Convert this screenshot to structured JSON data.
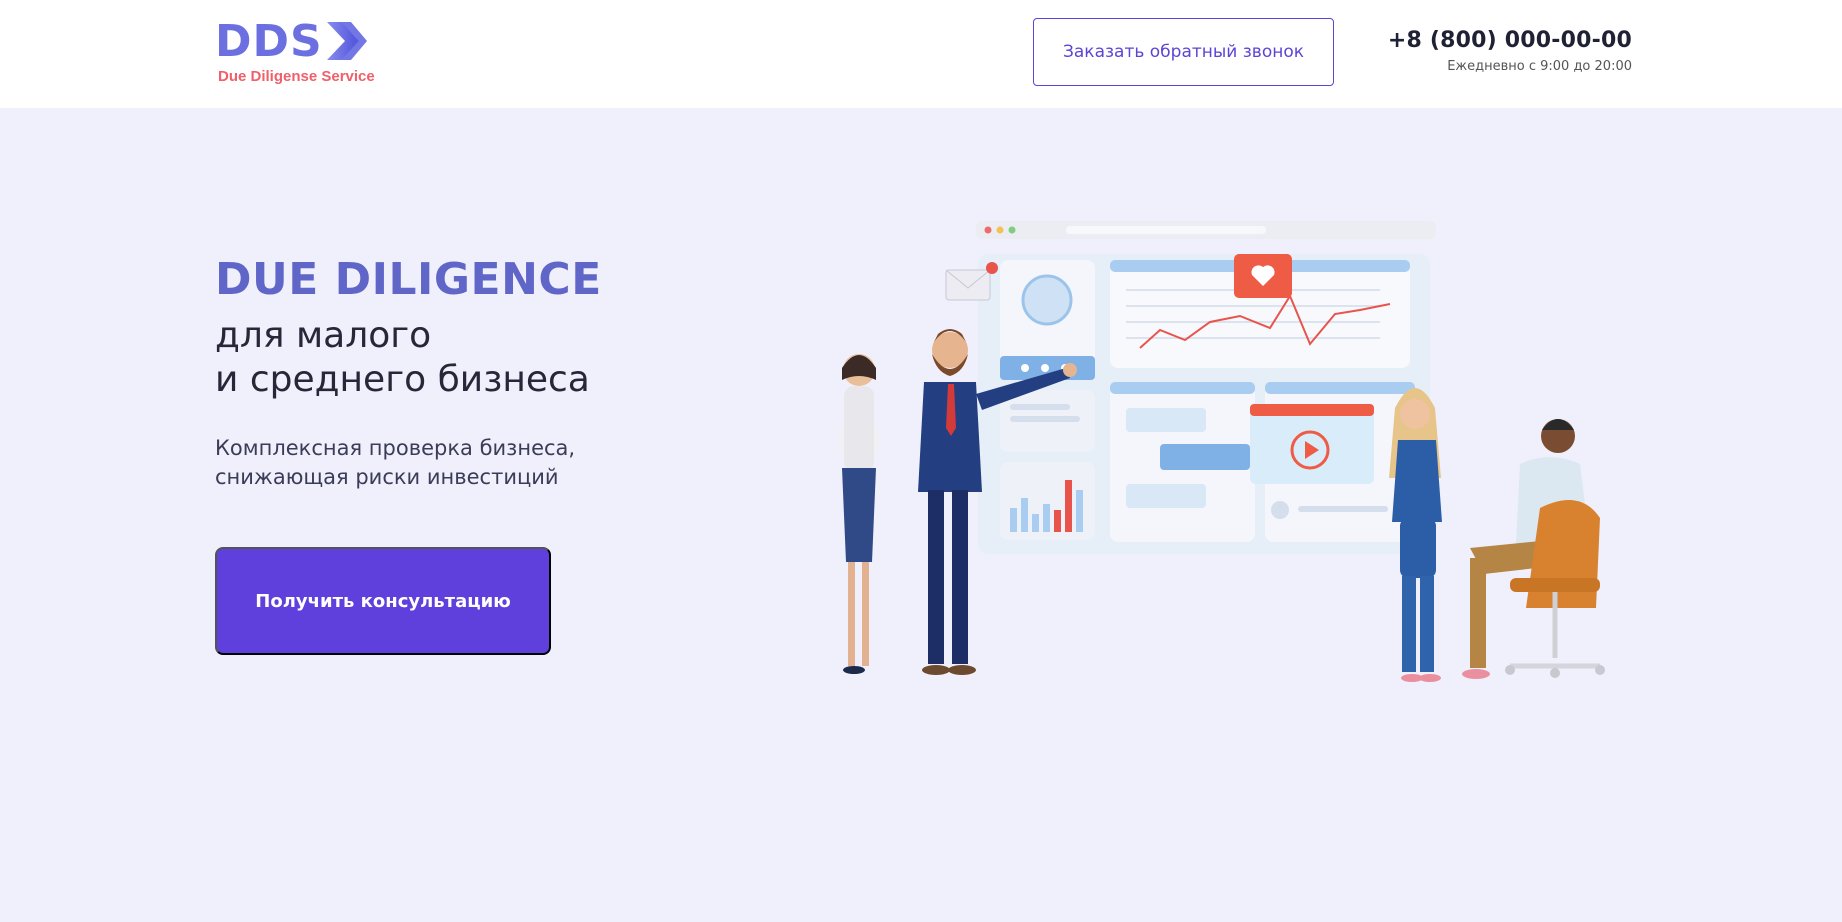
{
  "header": {
    "logo": {
      "word": "DDS",
      "tagline": "Due Diligense Service"
    },
    "callback_button": "Заказать обратный звонок",
    "phone": {
      "number": "+8 (800) 000-00-00",
      "hours": "Ежедневно с 9:00 до 20:00"
    }
  },
  "hero": {
    "title": "DUE DILIGENCE",
    "subtitle_lines": [
      "для малого",
      "и среднего бизнеса"
    ],
    "description_lines": [
      "Комплексная проверка бизнеса,",
      "снижающая риски инвестиций"
    ],
    "cta_button": "Получить консультацию"
  },
  "colors": {
    "accent": "#5f40dc",
    "title": "#6065c8",
    "hero_bg": "#f0f0fc",
    "logo_tagline": "#f0606a"
  },
  "icons": [
    "logo-arrow-icon",
    "heart-icon",
    "mail-icon",
    "play-icon",
    "phone-icon",
    "chat-icon",
    "gear-icon"
  ]
}
